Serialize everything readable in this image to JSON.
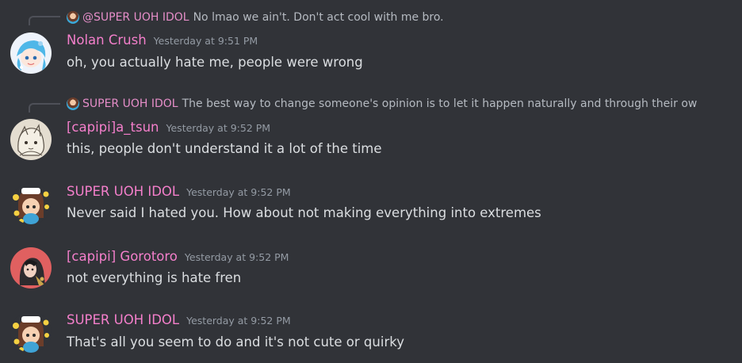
{
  "messages": [
    {
      "reply": {
        "author": "@SUPER UOH IDOL",
        "text": "No lmao we ain't. Don't act cool with me bro."
      },
      "author": "Nolan Crush",
      "timestamp": "Yesterday at 9:51 PM",
      "content": "oh, you actually hate me, people were wrong"
    },
    {
      "reply": {
        "author": "SUPER UOH IDOL",
        "text": "The best way to change someone's opinion is to let it happen naturally and through their ow"
      },
      "author": "[capipi]a_tsun",
      "timestamp": "Yesterday at 9:52 PM",
      "content": "this, people don't understand it a lot of the time"
    },
    {
      "author": "SUPER UOH IDOL",
      "timestamp": "Yesterday at 9:52 PM",
      "content": "Never said I hated you. How about not making everything into extremes"
    },
    {
      "author": "[capipi] Gorotoro",
      "timestamp": "Yesterday at 9:52 PM",
      "content": "not everything is hate fren"
    },
    {
      "author": "SUPER UOH IDOL",
      "timestamp": "Yesterday at 9:52 PM",
      "content": "That's all you seem to do and it's not cute or quirky"
    }
  ],
  "colors": {
    "background": "#313338",
    "author_pink": "#f47fcb",
    "reply_author_pink": "#e68ec9",
    "timestamp_gray": "#949ba4",
    "message_text": "#dbdee1"
  }
}
